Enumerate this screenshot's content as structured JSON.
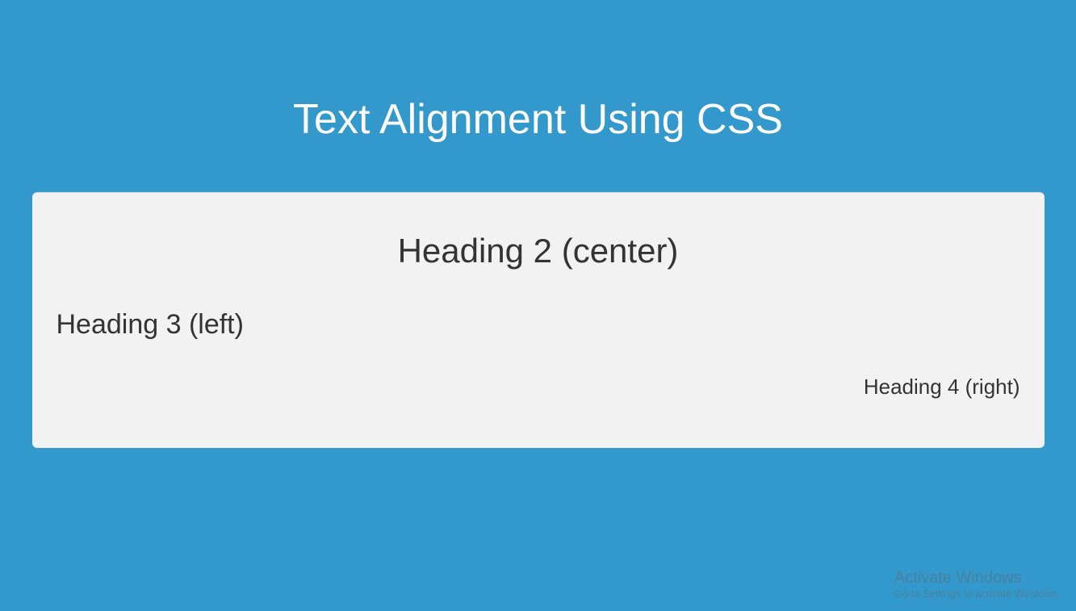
{
  "page": {
    "title": "Text Alignment Using CSS"
  },
  "box": {
    "heading2": "Heading 2 (center)",
    "heading3": "Heading 3 (left)",
    "heading4": "Heading 4 (right)"
  },
  "watermark": {
    "title": "Activate Windows",
    "subtitle": "Go to Settings to activate Windows."
  }
}
